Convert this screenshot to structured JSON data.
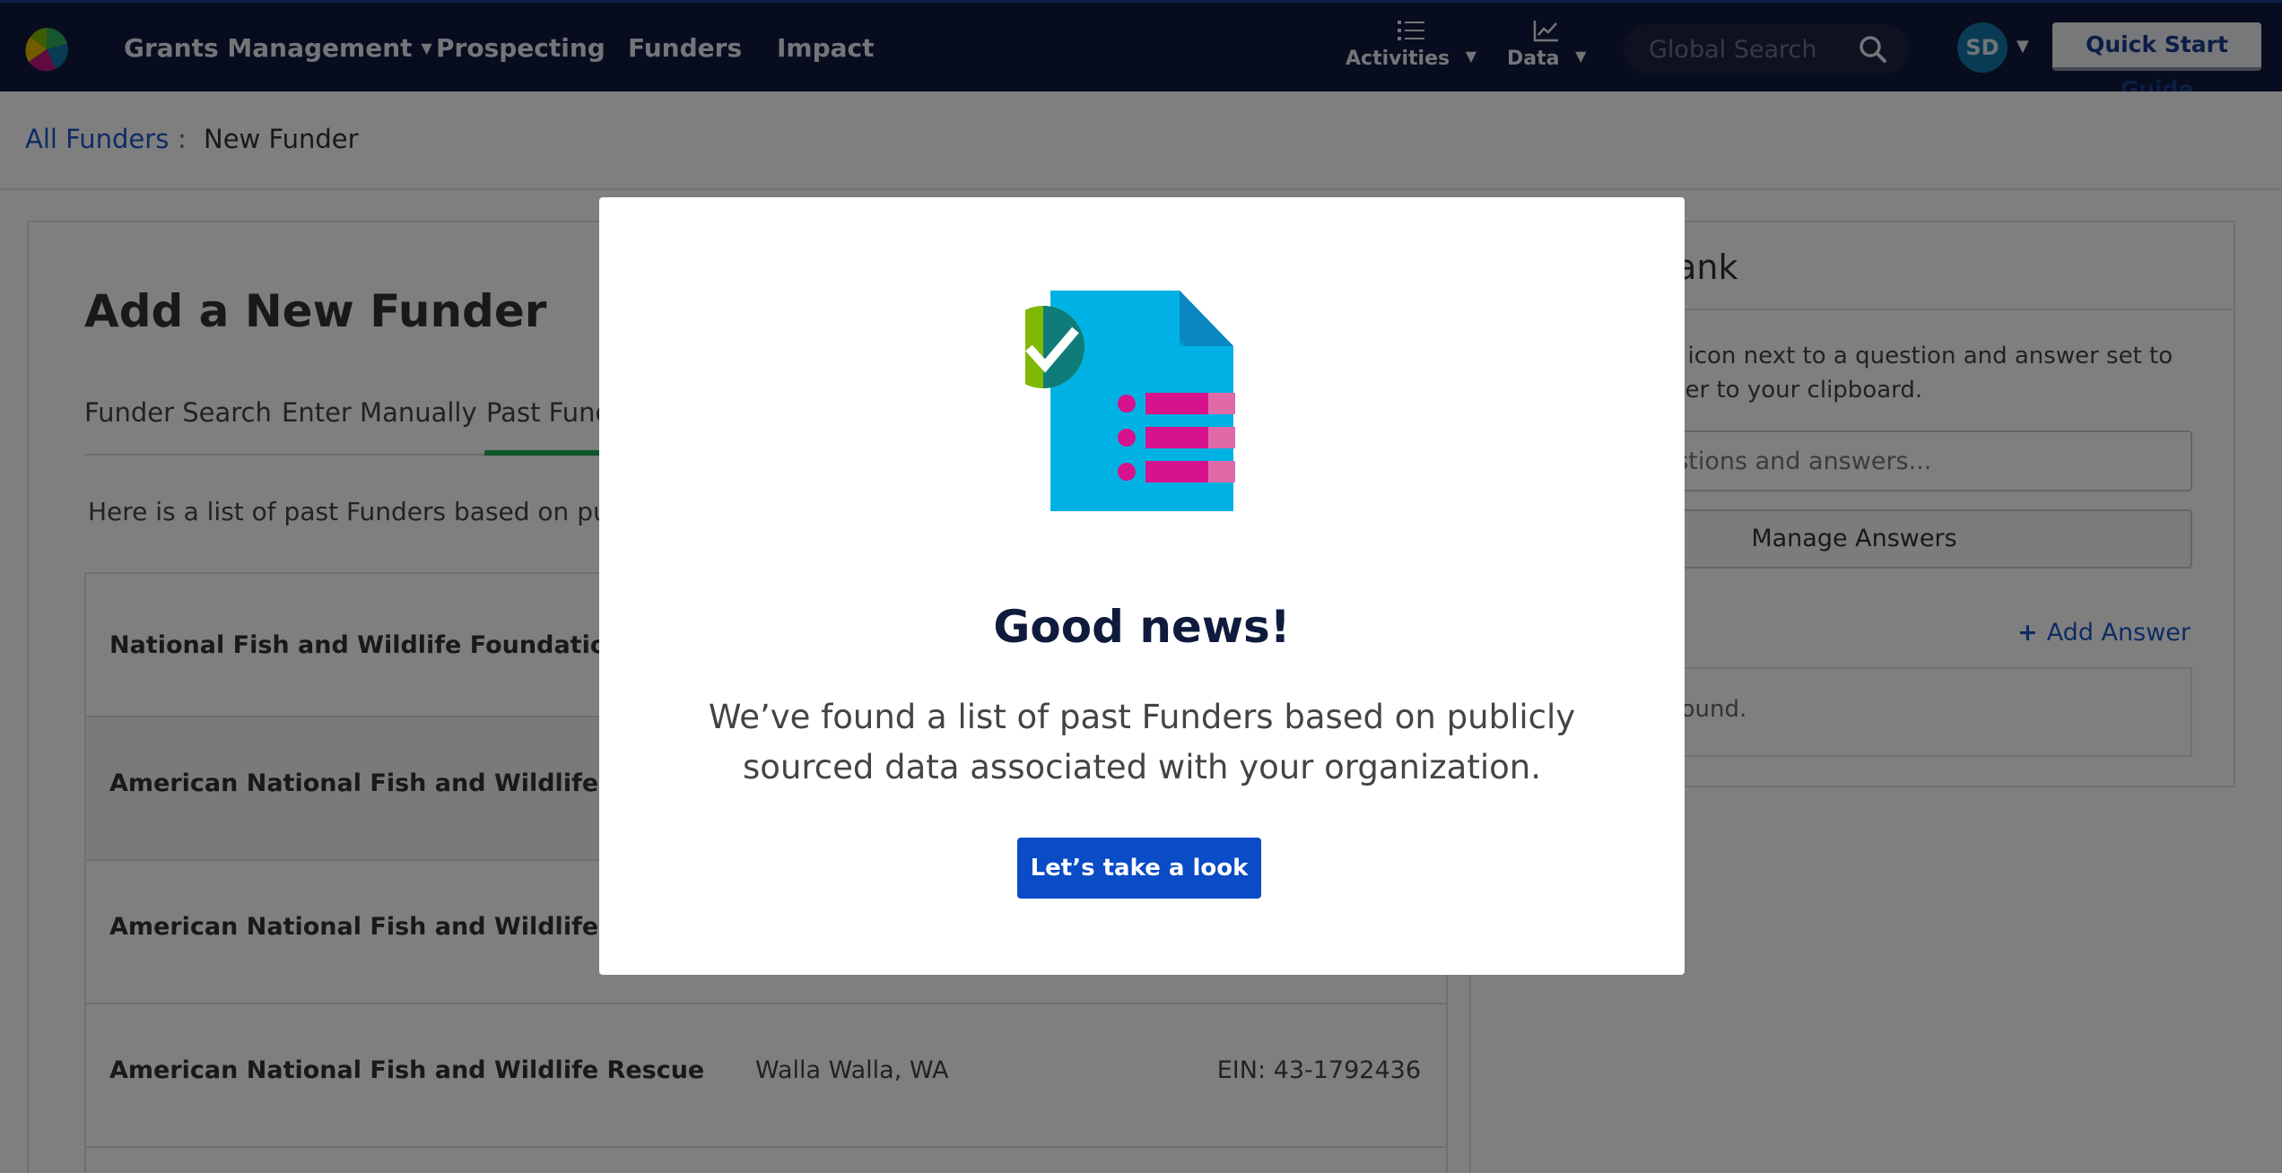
{
  "nav": {
    "items": [
      {
        "label": "Grants Management",
        "caret": "▼"
      },
      {
        "label": "Prospecting"
      },
      {
        "label": "Funders"
      },
      {
        "label": "Impact"
      }
    ],
    "activities_label": "Activities",
    "data_label": "Data",
    "caret": "▼",
    "search_placeholder": "Global Search",
    "avatar_initials": "SD",
    "quick_start_label": "Quick Start Guide"
  },
  "breadcrumb": {
    "link": "All Funders",
    "separator": ":",
    "current": "New Funder"
  },
  "main": {
    "title": "Add a New Funder",
    "tabs": [
      {
        "label": "Funder Search"
      },
      {
        "label": "Enter Manually"
      },
      {
        "label": "Past Funders",
        "active": true
      }
    ],
    "intro": "Here is a list of past Funders based on publicly sourced data associated with your organization.",
    "rows": [
      {
        "name": "National Fish and Wildlife Foundation",
        "location": "",
        "ein": ""
      },
      {
        "name": "American National Fish and Wildlife Museum",
        "location": "",
        "ein": ""
      },
      {
        "name": "American National Fish and Wildlife Rescue",
        "location": "",
        "ein": ""
      },
      {
        "name": "American National Fish and Wildlife Rescue",
        "location": "Walla Walla, WA",
        "ein": "EIN: 43-1792436"
      }
    ]
  },
  "answer_bank": {
    "title": "Answer Bank",
    "description": "Click the copy icon next to a question and answer set to copy the answer to your clipboard.",
    "search_placeholder": "Search questions and answers...",
    "manage_label": "Manage Answers",
    "add_label": "Add Answer",
    "empty_text": "No records found."
  },
  "modal": {
    "title": "Good news!",
    "body": "We’ve found a list of past Funders based on publicly sourced data associated with your organization.",
    "button_label": "Let’s take a look",
    "illustration": "document-checklist-icon"
  },
  "colors": {
    "nav_bg": "#0f1b3d",
    "link": "#1c56c8",
    "primary_button": "#0a4bc6",
    "active_tab": "#1faa55",
    "doc_blue": "#00b2e3",
    "doc_magenta": "#d6128c",
    "check_green": "#7fb800"
  }
}
